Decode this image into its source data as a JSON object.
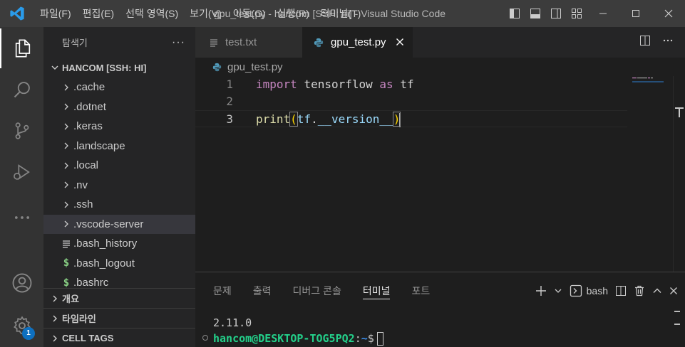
{
  "titlebar": {
    "menu": [
      "파일(F)",
      "편집(E)",
      "선택 영역(S)",
      "보기(V)",
      "이동(G)",
      "실행(R)",
      "터미널(T)"
    ],
    "window_title": "gpu_test.py - hancom [SSH: hi] - Visual Studio Code"
  },
  "activity": {
    "icons": [
      "explorer-icon",
      "search-icon",
      "source-control-icon",
      "run-debug-icon",
      "more-icon",
      "account-icon",
      "settings-icon"
    ],
    "settings_badge": "1"
  },
  "sidebar": {
    "title": "탐색기",
    "more": "···",
    "root_label": "HANCOM [SSH: HI]",
    "items": [
      {
        "label": ".cache",
        "kind": "folder"
      },
      {
        "label": ".dotnet",
        "kind": "folder"
      },
      {
        "label": ".keras",
        "kind": "folder"
      },
      {
        "label": ".landscape",
        "kind": "folder"
      },
      {
        "label": ".local",
        "kind": "folder"
      },
      {
        "label": ".nv",
        "kind": "folder"
      },
      {
        "label": ".ssh",
        "kind": "folder"
      },
      {
        "label": ".vscode-server",
        "kind": "folder"
      },
      {
        "label": ".bash_history",
        "kind": "file-text"
      },
      {
        "label": ".bash_logout",
        "kind": "file-shell"
      },
      {
        "label": ".bashrc",
        "kind": "file-shell"
      }
    ],
    "sections": [
      "개요",
      "타임라인",
      "CELL TAGS"
    ]
  },
  "editor": {
    "tabs": [
      {
        "label": "test.txt",
        "active": false
      },
      {
        "label": "gpu_test.py",
        "active": true
      }
    ],
    "breadcrumb": "gpu_test.py",
    "line_numbers": [
      "1",
      "2",
      "3"
    ],
    "code": {
      "line1": {
        "kw1": "import",
        "mod": "tensorflow",
        "kw2": "as",
        "alias": "tf"
      },
      "line3": {
        "fn": "print",
        "open": "(",
        "obj": "tf",
        "dot": ".",
        "attr": "__version__",
        "close": ")"
      }
    }
  },
  "panel": {
    "tabs": [
      "문제",
      "출력",
      "디버그 콘솔",
      "터미널",
      "포트"
    ],
    "active_tab": "터미널",
    "shell_label": "bash",
    "terminal": {
      "output": "2.11.0",
      "prompt_user": "hancom@DESKTOP-TOG5PQ2",
      "prompt_sep": ":",
      "prompt_path": "~",
      "prompt_char": "$"
    }
  },
  "colors": {
    "accent": "#0e70c0",
    "keyword": "#c586c0",
    "function": "#dcdcaa",
    "variable": "#9cdcfe",
    "bracket": "#ffd700",
    "terminal_user": "#23d18b",
    "terminal_path": "#3b8eea"
  }
}
